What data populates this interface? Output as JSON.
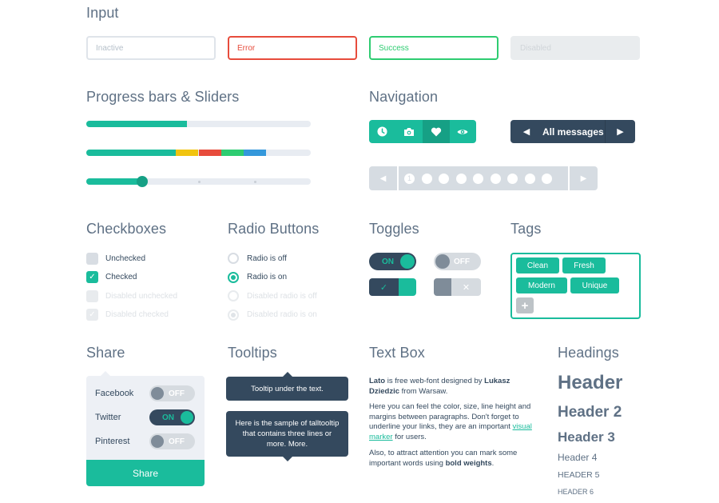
{
  "sections": {
    "input": "Input",
    "progress": "Progress bars & Sliders",
    "navigation": "Navigation",
    "checkboxes": "Checkboxes",
    "radio": "Radio Buttons",
    "toggles": "Toggles",
    "tags": "Tags",
    "share": "Share",
    "tooltips": "Tooltips",
    "textbox": "Text Box",
    "headings": "Headings"
  },
  "inputs": [
    {
      "state": "inactive",
      "placeholder": "Inactive"
    },
    {
      "state": "error",
      "value": "Error"
    },
    {
      "state": "success",
      "value": "Success"
    },
    {
      "state": "disabled",
      "placeholder": "Disabled"
    }
  ],
  "colors": {
    "accent": "#1abc9c",
    "dark": "#34495e",
    "error": "#e74c3c",
    "success": "#2ecc71",
    "warning": "#f1c40f",
    "info": "#3498db"
  },
  "progress": {
    "single": {
      "percent": 45,
      "color": "#1abc9c"
    },
    "stacked": [
      {
        "percent": 40,
        "color": "#1abc9c"
      },
      {
        "percent": 10,
        "color": "#f1c40f"
      },
      {
        "percent": 10,
        "color": "#e74c3c"
      },
      {
        "percent": 10,
        "color": "#2ecc71"
      },
      {
        "percent": 10,
        "color": "#3498db"
      }
    ],
    "slider": {
      "percent": 25,
      "ticks": [
        50,
        75
      ]
    }
  },
  "navigation": {
    "icon_nav": [
      {
        "icon": "clock-icon",
        "active": false
      },
      {
        "icon": "camera-icon",
        "active": false
      },
      {
        "icon": "heart-icon",
        "active": true
      },
      {
        "icon": "eye-icon",
        "active": false
      }
    ],
    "messages": {
      "label": "All messages",
      "prev_icon": "◀",
      "next_icon": "▶"
    },
    "pager": {
      "prev_icon": "◀",
      "next_icon": "▶",
      "current": "1",
      "page_count": 9
    }
  },
  "checkboxes": [
    {
      "label": "Unchecked",
      "checked": false,
      "disabled": false
    },
    {
      "label": "Checked",
      "checked": true,
      "disabled": false
    },
    {
      "label": "Disabled unchecked",
      "checked": false,
      "disabled": true
    },
    {
      "label": "Disabled checked",
      "checked": true,
      "disabled": true
    }
  ],
  "radios": [
    {
      "label": "Radio is off",
      "on": false,
      "disabled": false
    },
    {
      "label": "Radio is on",
      "on": true,
      "disabled": false
    },
    {
      "label": "Disabled radio is off",
      "on": false,
      "disabled": true
    },
    {
      "label": "Disabled radio is on",
      "on": true,
      "disabled": true
    }
  ],
  "toggles": {
    "on_label": "ON",
    "off_label": "OFF",
    "check_glyph": "✓",
    "cross_glyph": "✕"
  },
  "tags": {
    "items": [
      "Clean",
      "Fresh",
      "Modern",
      "Unique"
    ],
    "add_glyph": "+"
  },
  "share": {
    "items": [
      {
        "label": "Facebook",
        "state": "OFF"
      },
      {
        "label": "Twitter",
        "state": "ON"
      },
      {
        "label": "Pinterest",
        "state": "OFF"
      }
    ],
    "button": "Share"
  },
  "tooltips": {
    "short": "Tooltip under the text.",
    "tall": "Here is the sample of talltooltip that contains three lines or more. More."
  },
  "textbox": {
    "p1_bold1": "Lato",
    "p1_text1": " is free web-font designed by ",
    "p1_bold2": "Lukasz Dziedzic",
    "p1_text2": " from Warsaw.",
    "p2_text1": "Here you can feel the color, size, line height and margins between paragraphs. Don't forget to underline your links, they are an important ",
    "p2_link": "visual marker",
    "p2_text2": " for users.",
    "p3_text1": "Also, to attract attention you can mark some important words using ",
    "p3_bold": "bold weights",
    "p3_text2": "."
  },
  "headings": {
    "h1": "Header",
    "h2": "Header 2",
    "h3": "Header 3",
    "h4": "Header 4",
    "h5": "HEADER 5",
    "h6": "HEADER 6"
  }
}
